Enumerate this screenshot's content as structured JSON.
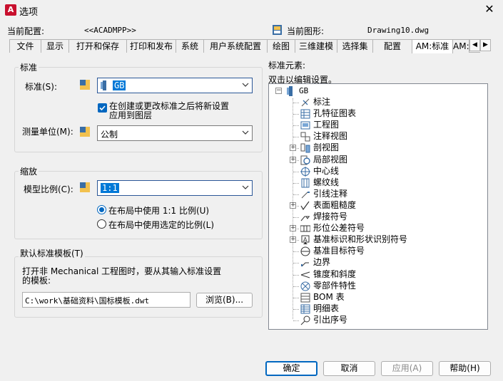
{
  "window": {
    "title": "选项",
    "app_icon_letter": "A"
  },
  "header": {
    "current_profile_label": "当前配置:",
    "current_profile_value": "<<ACADMPP>>",
    "current_drawing_label": "当前图形:",
    "current_drawing_value": "Drawing10.dwg"
  },
  "tabs": [
    {
      "label": "文件"
    },
    {
      "label": "显示"
    },
    {
      "label": "打开和保存"
    },
    {
      "label": "打印和发布"
    },
    {
      "label": "系统"
    },
    {
      "label": "用户系统配置"
    },
    {
      "label": "绘图"
    },
    {
      "label": "三维建模"
    },
    {
      "label": "选择集"
    },
    {
      "label": "配置"
    },
    {
      "label": "AM:标准"
    },
    {
      "label": "AM:S"
    }
  ],
  "standard_group": {
    "title": "标准",
    "standard_label": "标准(S):",
    "standard_value": "GB",
    "checkbox_text_line1": "在创建或更改标准之后将新设置",
    "checkbox_text_line2": "应用到图层",
    "checkbox_checked": true,
    "units_label": "测量单位(M):",
    "units_value": "公制"
  },
  "scale_group": {
    "title": "缩放",
    "model_scale_label": "模型比例(C):",
    "model_scale_value": "1:1",
    "radio1": "在布局中使用 1:1 比例(U)",
    "radio2": "在布局中使用选定的比例(L)",
    "selected_radio": 1
  },
  "template_group": {
    "title": "默认标准模板(T)",
    "description_line1": "打开非 Mechanical 工程图时，要从其输入标准设置",
    "description_line2": "的模板:",
    "path_value": "C:\\work\\基础资料\\国标模板.dwt",
    "browse_label": "浏览(B)..."
  },
  "elements": {
    "title": "标准元素:",
    "hint": "双击以编辑设置。",
    "root": "GB",
    "items": [
      {
        "label": "标注",
        "icon": "dimension-icon",
        "expandable": false
      },
      {
        "label": "孔特征图表",
        "icon": "hole-chart-icon",
        "expandable": false
      },
      {
        "label": "工程图",
        "icon": "drawing-view-icon",
        "expandable": false
      },
      {
        "label": "注释视图",
        "icon": "annotation-view-icon",
        "expandable": false
      },
      {
        "label": "剖视图",
        "icon": "section-view-icon",
        "expandable": true
      },
      {
        "label": "局部视图",
        "icon": "detail-view-icon",
        "expandable": true
      },
      {
        "label": "中心线",
        "icon": "centerline-icon",
        "expandable": false
      },
      {
        "label": "螺纹线",
        "icon": "thread-icon",
        "expandable": false
      },
      {
        "label": "引线注释",
        "icon": "leader-note-icon",
        "expandable": false
      },
      {
        "label": "表面粗糙度",
        "icon": "surface-texture-icon",
        "expandable": true
      },
      {
        "label": "焊接符号",
        "icon": "weld-symbol-icon",
        "expandable": false
      },
      {
        "label": "形位公差符号",
        "icon": "fcf-icon",
        "expandable": true
      },
      {
        "label": "基准标识和形状识别符号",
        "icon": "datum-id-icon",
        "expandable": true
      },
      {
        "label": "基准目标符号",
        "icon": "datum-target-icon",
        "expandable": false
      },
      {
        "label": "边界",
        "icon": "boundary-icon",
        "expandable": false
      },
      {
        "label": "锥度和斜度",
        "icon": "taper-slope-icon",
        "expandable": false
      },
      {
        "label": "零部件特性",
        "icon": "part-property-icon",
        "expandable": false
      },
      {
        "label": "BOM 表",
        "icon": "bom-icon",
        "expandable": false
      },
      {
        "label": "明细表",
        "icon": "parts-list-icon",
        "expandable": false
      },
      {
        "label": "引出序号",
        "icon": "balloon-icon",
        "expandable": false
      }
    ]
  },
  "footer": {
    "ok": "确定",
    "cancel": "取消",
    "apply": "应用(A)",
    "help": "帮助(H)"
  },
  "colors": {
    "accent": "#0067c0",
    "selection": "#0078d7",
    "app_red": "#c8102e"
  }
}
